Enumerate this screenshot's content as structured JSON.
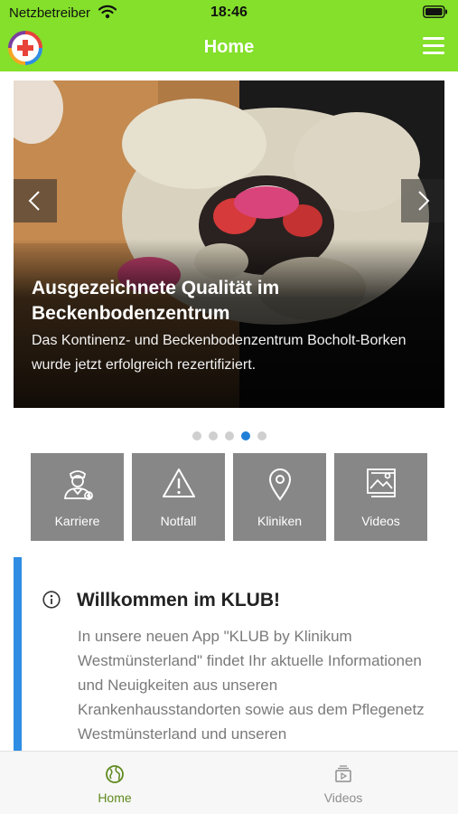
{
  "status_bar": {
    "carrier": "Netzbetreiber",
    "time": "18:46"
  },
  "nav": {
    "title": "Home"
  },
  "slider": {
    "title": "Ausgezeichnete Qualität im Beckenbodenzentrum",
    "description": "Das Kontinenz- und Beckenbodenzentrum Bocholt-Borken wurde jetzt erfolgreich rezertifiziert.",
    "slide_count": 5,
    "active_slide": 4
  },
  "tiles": [
    {
      "label": "Karriere",
      "icon": "doctor-icon"
    },
    {
      "label": "Notfall",
      "icon": "warning-icon"
    },
    {
      "label": "Kliniken",
      "icon": "location-pin-icon"
    },
    {
      "label": "Videos",
      "icon": "gallery-icon"
    }
  ],
  "welcome": {
    "title": "Willkommen im KLUB!",
    "text": "In unsere neuen App \"KLUB by Klinikum Westmünsterland\" findet Ihr aktuelle Informationen und Neuigkeiten aus unseren Krankenhausstandorten sowie aus dem Pflegenetz Westmünsterland und unseren"
  },
  "tabbar": {
    "items": [
      {
        "label": "Home",
        "icon": "globe-icon",
        "active": true
      },
      {
        "label": "Videos",
        "icon": "video-icon",
        "active": false
      }
    ]
  },
  "colors": {
    "header": "#84e02a",
    "accent": "#2f8de3",
    "tile": "#878787",
    "active_tab": "#5e8a1e"
  }
}
